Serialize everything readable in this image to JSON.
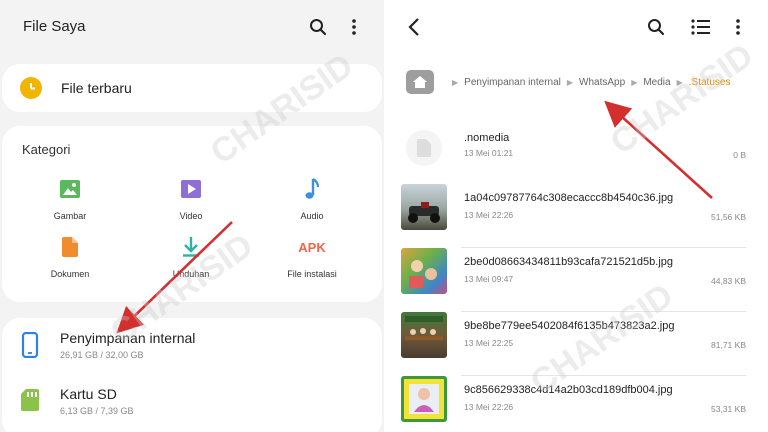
{
  "left": {
    "title": "File Saya",
    "recent": {
      "label": "File terbaru"
    },
    "categories": {
      "heading": "Kategori",
      "items": [
        {
          "label": "Gambar"
        },
        {
          "label": "Video"
        },
        {
          "label": "Audio"
        },
        {
          "label": "Dokumen"
        },
        {
          "label": "Unduhan"
        },
        {
          "label": "File instalasi",
          "icon_text": "APK"
        }
      ]
    },
    "storage": [
      {
        "name": "Penyimpanan internal",
        "usage": "26,91 GB / 32,00 GB"
      },
      {
        "name": "Kartu SD",
        "usage": "6,13 GB / 7,39 GB"
      }
    ]
  },
  "right": {
    "breadcrumb": [
      "Penyimpanan internal",
      "WhatsApp",
      "Media",
      ".Statuses"
    ],
    "files": [
      {
        "name": ".nomedia",
        "date": "13 Mei 01:21",
        "size": "0 B"
      },
      {
        "name": "1a04c09787764c308ecaccc8b4540c36.jpg",
        "date": "13 Mei 22:26",
        "size": "51,56 KB"
      },
      {
        "name": "2be0d08663434811b93cafa721521d5b.jpg",
        "date": "13 Mei 09:47",
        "size": "44,83 KB"
      },
      {
        "name": "9be8be779ee5402084f6135b473823a2.jpg",
        "date": "13 Mei 22:25",
        "size": "81,71 KB"
      },
      {
        "name": "9c856629338c4d14a2b03cd189dfb004.jpg",
        "date": "13 Mei 22:26",
        "size": "53,31 KB"
      }
    ]
  },
  "watermark": "CHARISID",
  "colors": {
    "accent_orange": "#e68a00",
    "clock_yellow": "#f1b500",
    "arrow_red": "#d32f2f"
  }
}
